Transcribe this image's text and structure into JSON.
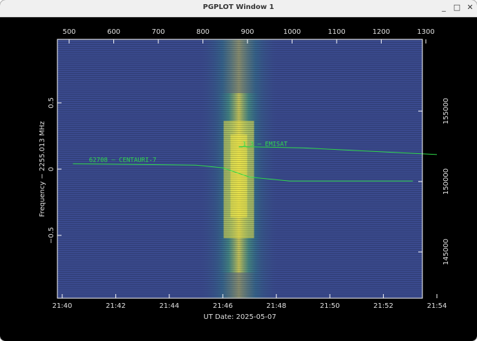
{
  "window": {
    "title": "PGPLOT Window 1",
    "buttons": {
      "minimize": "_",
      "maximize": "□",
      "close": "✕"
    }
  },
  "chart_data": {
    "type": "heatmap",
    "title": "",
    "xlabel": "UT Date: 2025-05-07",
    "ylabel": "Frequency − 2255.013 MHz",
    "x_ticks": [
      "21:40",
      "21:42",
      "21:44",
      "21:46",
      "21:48",
      "21:50",
      "21:52",
      "21:54"
    ],
    "x_range_minutes": [
      0,
      14
    ],
    "y_ticks": [
      0.5,
      0,
      -0.5
    ],
    "y_labels": [
      "0.5",
      "0",
      "−0.5"
    ],
    "y_range": [
      -1,
      1
    ],
    "top_axis_ticks": [
      500,
      600,
      700,
      800,
      900,
      1000,
      1100,
      1200,
      1300
    ],
    "right_axis_ticks": [
      155000,
      150000,
      145000
    ],
    "background_color": "#3a4a8e",
    "signal_color": "#f0e84a",
    "track_color": "#2fdc4a",
    "signal_center_minute": 6.6,
    "tracks": [
      {
        "label": "62708 – CENTAURI-7",
        "label_minute": 1.0,
        "label_y": 0.05,
        "points": [
          [
            0.4,
            0.04
          ],
          [
            5.0,
            0.03
          ],
          [
            6.0,
            0.01
          ],
          [
            7.0,
            -0.06
          ],
          [
            8.5,
            -0.09
          ],
          [
            11.0,
            -0.09
          ],
          [
            13.1,
            -0.09
          ]
        ]
      },
      {
        "label": "_1_3 – EMISAT",
        "label_minute": 6.6,
        "label_y": 0.17,
        "points": [
          [
            6.6,
            0.17
          ],
          [
            9.0,
            0.16
          ],
          [
            12.0,
            0.13
          ],
          [
            14.0,
            0.11
          ]
        ]
      }
    ]
  }
}
